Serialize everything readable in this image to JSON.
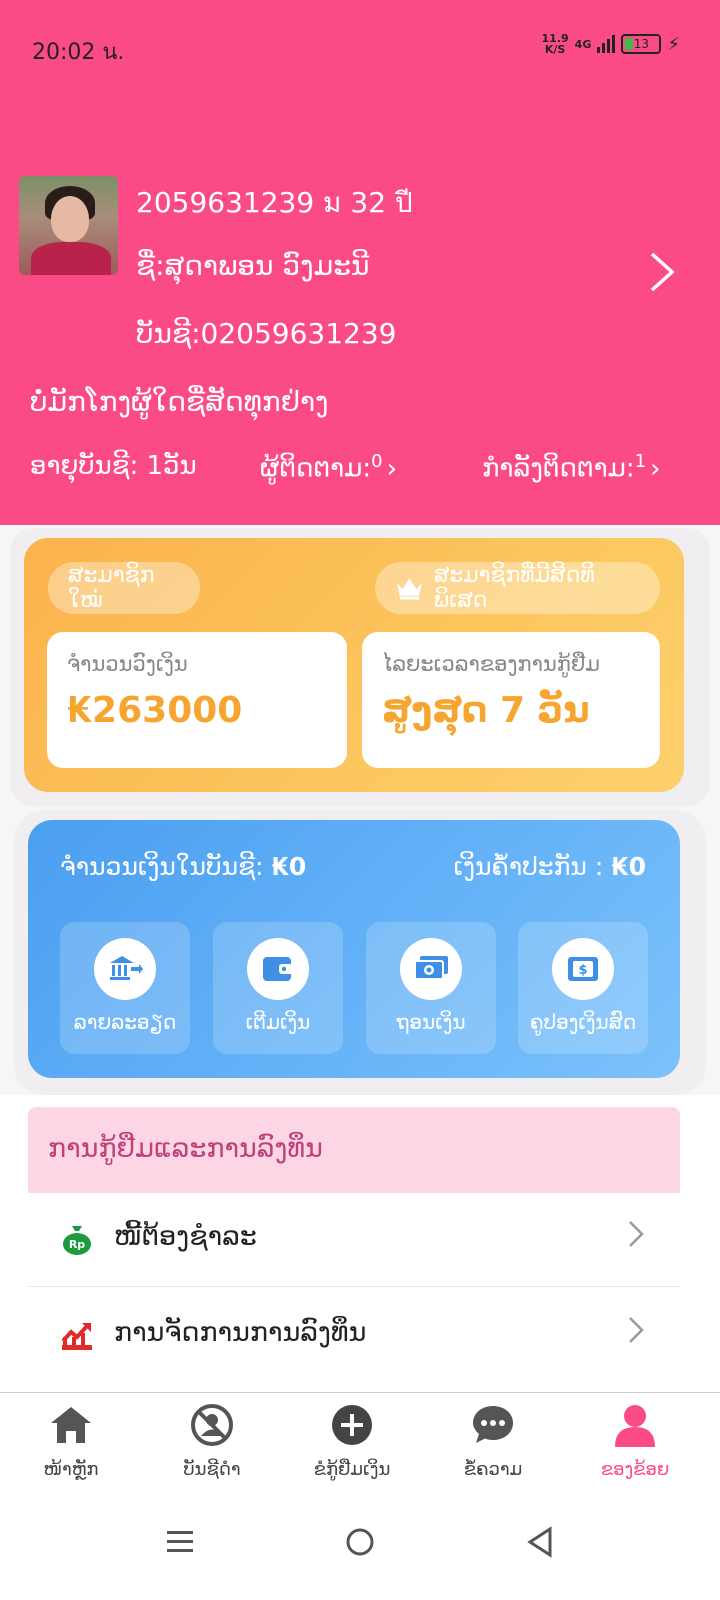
{
  "status_bar": {
    "time": "20:02 น.",
    "net_speed_value": "11.9",
    "net_speed_unit": "K/S",
    "network": "4G",
    "battery": "13"
  },
  "profile": {
    "id_line": "2059631239   ม   32 ปี",
    "name_line": "ຊື່:ສຸດາພອນ ວົງມະນີ",
    "account_line": "ບັນຊີ:02059631239",
    "bio": "ບໍ່ມັກໂກງຜູ້ໃດຊື່ສັດທຸກຢ່າງ",
    "account_age": "ອາຍຸບັນຊີ: 1ວັນ",
    "followers_label": "ຜູ້ຕິດຕາມ:",
    "followers_count": "0",
    "following_label": "ກຳລັງຕິດຕາມ:",
    "following_count": "1"
  },
  "member_card": {
    "new_member": "ສະມາຊິກໃໝ່",
    "vip_member": "ສະມາຊິກທີ່ມີສິດທິພິເສດ",
    "amount_label": "ຈຳນວນວົງເງິນ",
    "amount_value": "₭263000",
    "period_label": "ໄລຍະເວລາຂອງການກູ້ຢືມ",
    "period_value": "ສູງສຸດ 7 ວັນ"
  },
  "wallet": {
    "balance_label": "ຈຳນວນເງິນໃນບັນຊີ: ",
    "balance_value": "₭0",
    "deposit_label": "ເງິນຄໍ້າປະກັນ : ",
    "deposit_value": "₭0",
    "actions": [
      {
        "label": "ລາຍລະອຽດ",
        "icon": "bank-transfer-icon"
      },
      {
        "label": "ເຕີມເງິນ",
        "icon": "wallet-icon"
      },
      {
        "label": "ຖອນເງິນ",
        "icon": "cash-icon"
      },
      {
        "label": "ຄູປອງເງິນສົດ",
        "icon": "coupon-icon"
      }
    ]
  },
  "loans_section": {
    "title": "ການກູ້ຢືມແລະການລົງທຶນ",
    "items": [
      {
        "label": "ໜີ້ຕ້ອງຊຳລະ",
        "icon": "money-bag-icon",
        "icon_text": "Rp"
      },
      {
        "label": "ການຈັດການການລົງທຶນ",
        "icon": "trend-chart-icon"
      }
    ]
  },
  "bottom_nav": {
    "items": [
      {
        "label": "ໜ້າຫຼັກ",
        "icon": "home-icon"
      },
      {
        "label": "ບັນຊີດຳ",
        "icon": "blacklist-icon"
      },
      {
        "label": "ຂໍກູ້ຢືມເງິນ",
        "icon": "plus-circle-icon"
      },
      {
        "label": "ຂໍ້ຄວາມ",
        "icon": "message-icon"
      },
      {
        "label": "ຂອງຂ້ອຍ",
        "icon": "person-icon"
      }
    ],
    "active_color": "#fb4b86"
  },
  "colors": {
    "header": "#fb4b86",
    "member_card": "#fbb24c",
    "wallet": "#5aa9f5",
    "amount": "#f7a531"
  }
}
